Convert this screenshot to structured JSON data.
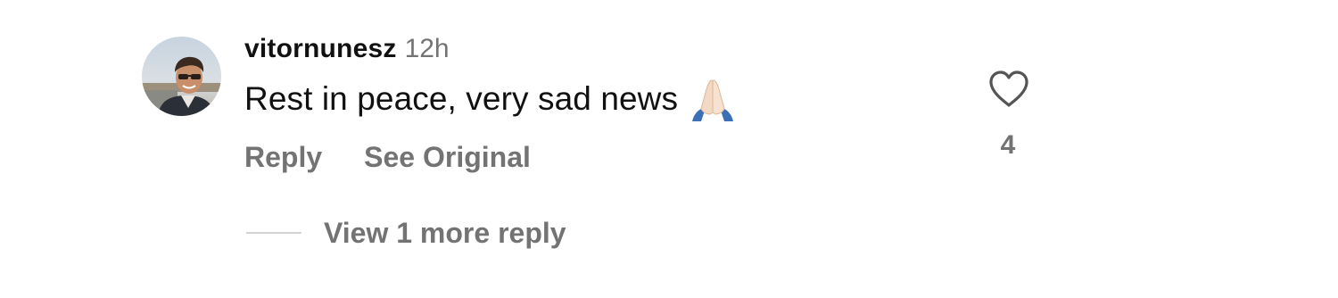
{
  "comment": {
    "username": "vitornunesz",
    "timestamp": "12h",
    "text": "Rest in peace, very sad news",
    "emoji": "folded-hands-emoji",
    "like_count": "4"
  },
  "actions": {
    "reply_label": "Reply",
    "see_original_label": "See Original"
  },
  "replies": {
    "view_more_label": "View 1 more reply"
  },
  "icons": {
    "like": "heart-outline-icon"
  },
  "colors": {
    "primary_text": "#111111",
    "secondary_text": "#737373",
    "divider": "#d4d4d4",
    "background": "#ffffff"
  }
}
